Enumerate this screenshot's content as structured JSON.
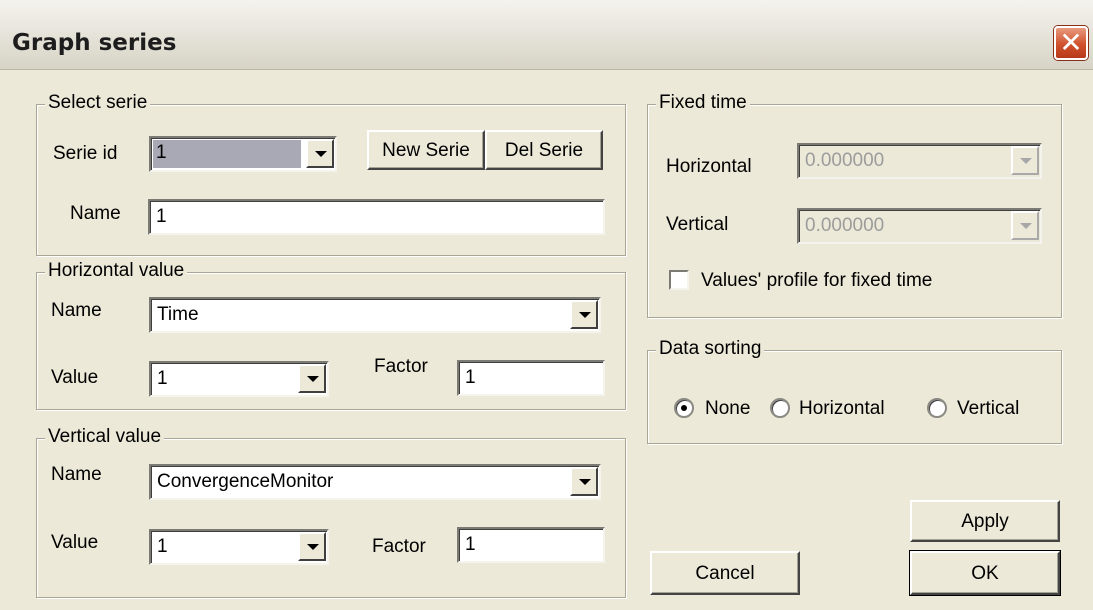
{
  "window": {
    "title": "Graph series",
    "close_glyph": "✕"
  },
  "select_serie": {
    "legend": "Select serie",
    "serie_id_label": "Serie id",
    "serie_id_value": "1",
    "new_button": "New Serie",
    "del_button": "Del Serie",
    "name_label": "Name",
    "name_value": "1"
  },
  "horizontal_value": {
    "legend": "Horizontal value",
    "name_label": "Name",
    "name_value": "Time",
    "value_label": "Value",
    "value_value": "1",
    "factor_label": "Factor",
    "factor_value": "1"
  },
  "vertical_value": {
    "legend": "Vertical value",
    "name_label": "Name",
    "name_value": "ConvergenceMonitor",
    "value_label": "Value",
    "value_value": "1",
    "factor_label": "Factor",
    "factor_value": "1"
  },
  "fixed_time": {
    "legend": "Fixed time",
    "horizontal_label": "Horizontal",
    "horizontal_value": "0.000000",
    "vertical_label": "Vertical",
    "vertical_value": "0.000000",
    "profile_checkbox_label": "Values' profile for fixed time",
    "profile_checked": false
  },
  "data_sorting": {
    "legend": "Data sorting",
    "options": [
      "None",
      "Horizontal",
      "Vertical"
    ],
    "selected": "None"
  },
  "buttons": {
    "apply": "Apply",
    "cancel": "Cancel",
    "ok": "OK"
  },
  "colors": {
    "dialog_bg": "#ece9d8",
    "close_button": "#d0512c"
  }
}
